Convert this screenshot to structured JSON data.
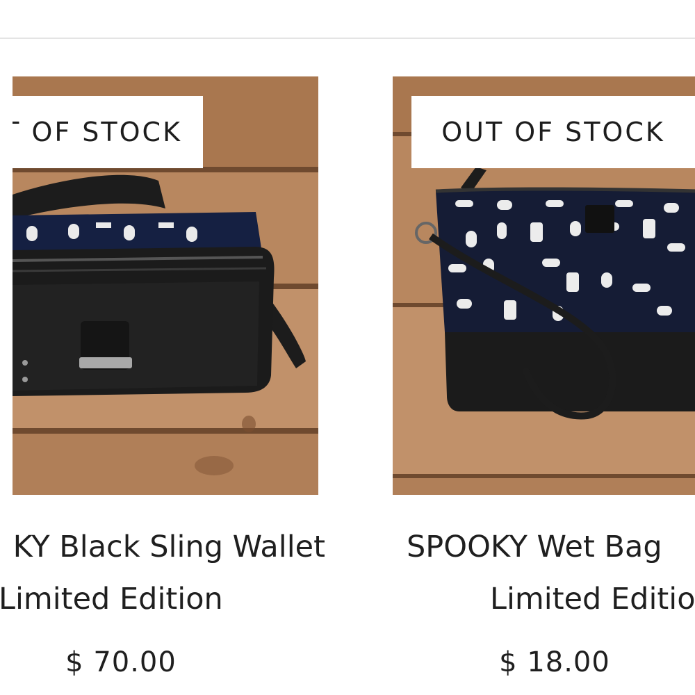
{
  "products": [
    {
      "badge": "T OF STOCK",
      "title_line1": "KY Black Sling Wallet",
      "title_line2": "Limited Edition",
      "price": "$ 70.00",
      "image_alt": "black sling wallet with ghost print lining"
    },
    {
      "badge": "OUT OF STOCK",
      "title_line1": "SPOOKY Wet Bag",
      "title_line2": "Limited Editio",
      "price": "$ 18.00",
      "image_alt": "wet bag with spooky print and wristlet strap"
    }
  ],
  "colors": {
    "wood": "#b07f58",
    "wood_dark": "#8a5d3d",
    "leather": "#1b1b1b",
    "print_bg": "#141c33",
    "badge_bg": "#ffffff",
    "text": "#1f1f1f",
    "rule": "#e4e4e4"
  }
}
